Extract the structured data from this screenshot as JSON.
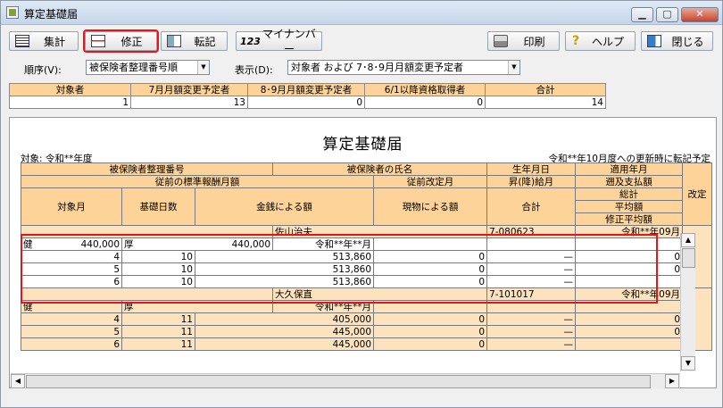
{
  "window": {
    "title": "算定基礎届"
  },
  "toolbar": {
    "summary": "集計",
    "edit": "修正",
    "transfer": "転記",
    "mynumber": "マイナンバー",
    "print": "印刷",
    "help": "ヘルプ",
    "close": "閉じる",
    "mynumber_prefix": "123"
  },
  "filters": {
    "order_label": "順序(V):",
    "order_value": "被保険者整理番号順",
    "display_label": "表示(D):",
    "display_value": "対象者 および 7･8･9月月額変更予定者"
  },
  "summary": {
    "headers": [
      "対象者",
      "7月月額変更予定者",
      "8･9月月額変更予定者",
      "6/1以降資格取得者",
      "合計"
    ],
    "values": [
      "1",
      "13",
      "0",
      "0",
      "14"
    ]
  },
  "doc": {
    "title": "算定基礎届",
    "target": "対象:  令和**年度",
    "note": "令和**年10月度への更新時に転記予定",
    "h_insured_no": "被保険者整理番号",
    "h_insured_name": "被保険者の氏名",
    "h_birth": "生年月日",
    "h_apply_month": "適用年月",
    "h_prev_std": "従前の標準報酬月額",
    "h_prev_revise": "従前改定月",
    "h_raise": "昇(降)給月",
    "h_retro": "遡及支払額",
    "h_month": "対象月",
    "h_days": "基礎日数",
    "h_cash": "金銭による額",
    "h_kind": "現物による額",
    "h_total": "合計",
    "h_grand": "総計",
    "h_avg": "平均額",
    "h_mod_avg": "修正平均額",
    "h_revise": "改定"
  },
  "records": [
    {
      "name": "佐山治夫",
      "birth": "7-080623",
      "apply": "令和**年09月",
      "health_label": "健",
      "health_value": "440,000",
      "pension_label": "厚",
      "pension_value": "440,000",
      "prev_revise": "令和**年**月",
      "months": [
        {
          "month": "4",
          "days": "10",
          "cash": "513,860",
          "kind": "0",
          "total": "—",
          "extra": "0"
        },
        {
          "month": "5",
          "days": "10",
          "cash": "513,860",
          "kind": "0",
          "total": "—",
          "extra": "0"
        },
        {
          "month": "6",
          "days": "10",
          "cash": "513,860",
          "kind": "0",
          "total": "—",
          "extra": ""
        }
      ]
    },
    {
      "name": "大久保直",
      "birth": "7-101017",
      "apply": "令和**年09月",
      "health_label": "健",
      "health_value": "",
      "pension_label": "厚",
      "pension_value": "",
      "prev_revise": "令和**年**月",
      "months": [
        {
          "month": "4",
          "days": "11",
          "cash": "405,000",
          "kind": "0",
          "total": "—",
          "extra": "0"
        },
        {
          "month": "5",
          "days": "11",
          "cash": "445,000",
          "kind": "0",
          "total": "—",
          "extra": "0"
        },
        {
          "month": "6",
          "days": "11",
          "cash": "445,000",
          "kind": "0",
          "total": "—",
          "extra": ""
        }
      ]
    }
  ],
  "colors": {
    "header": "#fdd39a",
    "row": "#fde3bd",
    "highlight": "#e8141b"
  }
}
